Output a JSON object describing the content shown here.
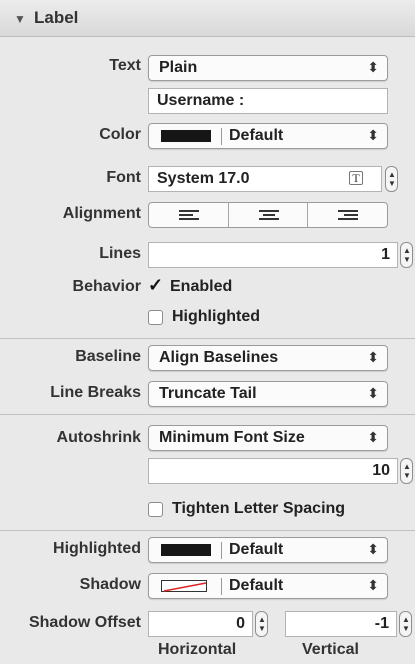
{
  "section": {
    "title": "Label",
    "collapse_icon": "disclosure-triangle-down-icon"
  },
  "text": {
    "label": "Text",
    "mode": "Plain",
    "value": "Username :"
  },
  "color": {
    "label": "Color",
    "value": "Default",
    "swatch": "#161616"
  },
  "font": {
    "label": "Font",
    "value": "System 17.0"
  },
  "alignment": {
    "label": "Alignment",
    "options": [
      "left",
      "center",
      "right"
    ],
    "selected": "left"
  },
  "lines": {
    "label": "Lines",
    "value": "1"
  },
  "behavior": {
    "label": "Behavior",
    "enabled_label": "Enabled",
    "enabled": true,
    "highlighted_label": "Highlighted",
    "highlighted": false
  },
  "baseline": {
    "label": "Baseline",
    "value": "Align Baselines"
  },
  "line_breaks": {
    "label": "Line Breaks",
    "value": "Truncate Tail"
  },
  "autoshrink": {
    "label": "Autoshrink",
    "value": "Minimum Font Size",
    "min_size": "10",
    "tighten_label": "Tighten Letter Spacing",
    "tighten": false
  },
  "highlighted_color": {
    "label": "Highlighted",
    "value": "Default",
    "swatch": "#161616"
  },
  "shadow": {
    "label": "Shadow",
    "value": "Default"
  },
  "shadow_offset": {
    "label": "Shadow Offset",
    "horizontal": "0",
    "vertical": "-1",
    "horizontal_label": "Horizontal",
    "vertical_label": "Vertical"
  }
}
